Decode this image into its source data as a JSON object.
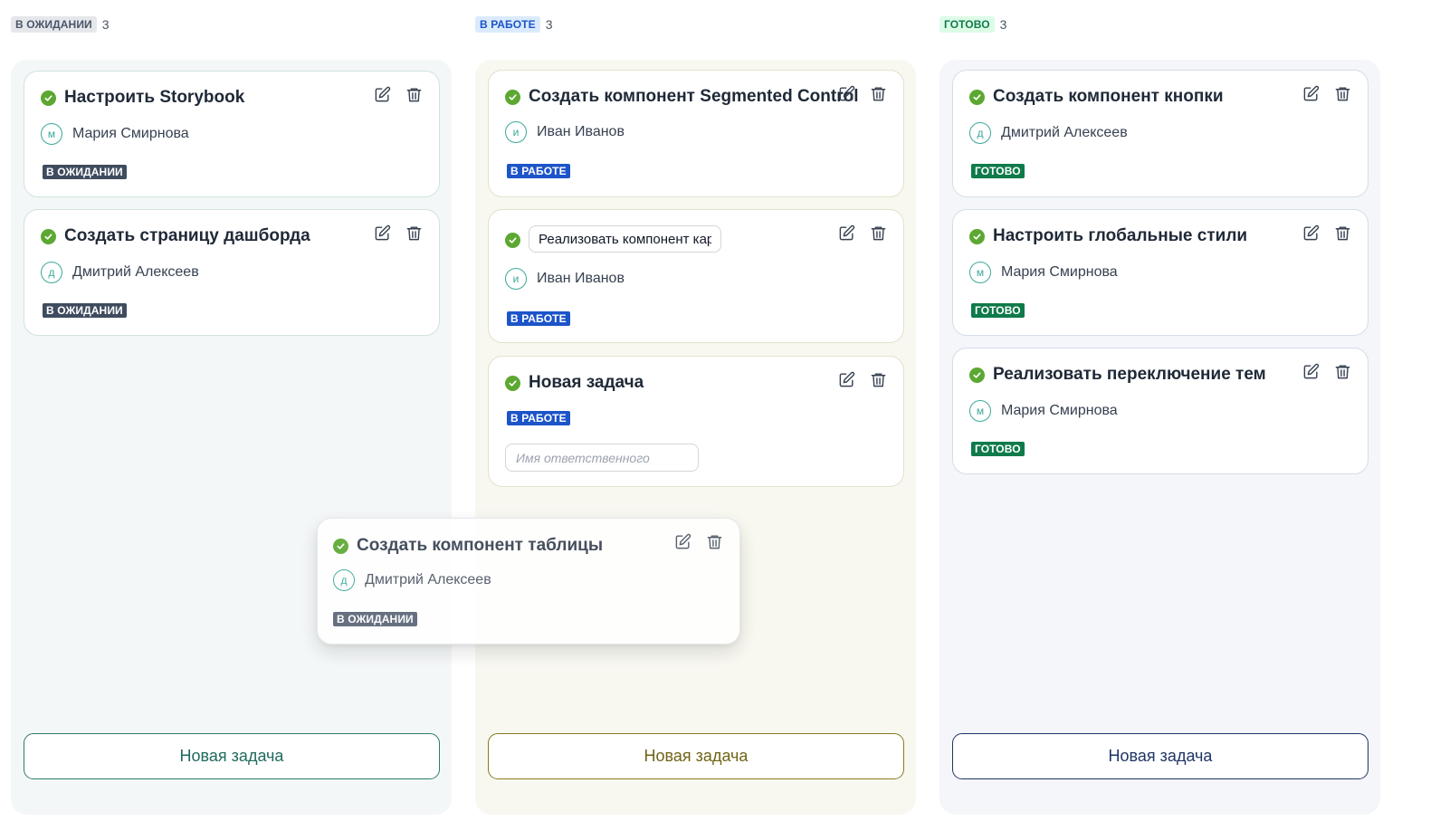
{
  "colors": {
    "pending": "#4a5568",
    "in_progress": "#1c54c9",
    "done": "#0f7a4a",
    "check": "#5ca832"
  },
  "columns": [
    {
      "header_badge": "В ОЖИДАНИИ",
      "count": "3",
      "new_task_label": "Новая задача",
      "cards": [
        {
          "title": "Настроить Storybook",
          "assignee_initial": "м",
          "assignee": "Мария Смирнова",
          "status": "В ОЖИДАНИИ"
        },
        {
          "title": "Создать страницу дашборда",
          "assignee_initial": "д",
          "assignee": "Дмитрий Алексеев",
          "status": "В ОЖИДАНИИ"
        }
      ]
    },
    {
      "header_badge": "В РАБОТЕ",
      "count": "3",
      "new_task_label": "Новая задача",
      "cards": [
        {
          "title": "Создать компонент Segmented Control",
          "assignee_initial": "и",
          "assignee": "Иван Иванов",
          "status": "В РАБОТЕ"
        },
        {
          "title_input_value": "Реализовать компонент карточки",
          "assignee_initial": "и",
          "assignee": "Иван Иванов",
          "status": "В РАБОТЕ"
        },
        {
          "title": "Новая задача",
          "status": "В РАБОТЕ",
          "assignee_placeholder": "Имя ответственного"
        }
      ]
    },
    {
      "header_badge": "ГОТОВО",
      "count": "3",
      "new_task_label": "Новая задача",
      "cards": [
        {
          "title": "Создать компонент кнопки",
          "assignee_initial": "д",
          "assignee": "Дмитрий Алексеев",
          "status": "ГОТОВО"
        },
        {
          "title": "Настроить глобальные стили",
          "assignee_initial": "м",
          "assignee": "Мария Смирнова",
          "status": "ГОТОВО"
        },
        {
          "title": "Реализовать переключение тем",
          "assignee_initial": "м",
          "assignee": "Мария Смирнова",
          "status": "ГОТОВО"
        }
      ]
    }
  ],
  "dragging_card": {
    "title": "Создать компонент таблицы",
    "assignee_initial": "д",
    "assignee": "Дмитрий Алексеев",
    "status": "В ОЖИДАНИИ"
  },
  "icons": {
    "check": "check-circle-icon",
    "edit": "edit-icon",
    "delete": "trash-icon"
  }
}
